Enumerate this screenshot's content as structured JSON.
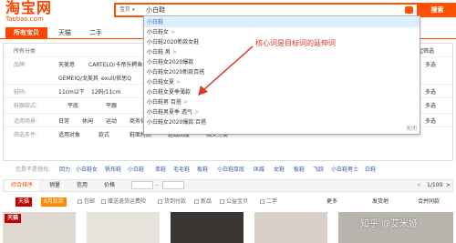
{
  "header": {
    "logo_main": "淘宝网",
    "logo_sub": "Taobao.com",
    "search_type": "宝贝",
    "search_value": "小白鞋",
    "search_button": "搜索"
  },
  "tabs": [
    "所有宝贝",
    "天猫",
    "二手"
  ],
  "filter_rows": {
    "location_label": "所有分类",
    "sidebar_label": "收起筛选",
    "brand_label": "品牌:",
    "brands_row1": [
      "天美意",
      "CARTELO/卡帝乐鳄鱼"
    ],
    "brands_row2": [
      "GEMEIQ/戈美其",
      "exull/依思Q"
    ],
    "more_label": "更多",
    "multi_label": "多选",
    "size_label": "鞋码:",
    "sizes": [
      "11cm以下",
      "12码/11cm"
    ],
    "style_label": "鞋跟款式:",
    "styles": [
      "平底",
      "平跟"
    ],
    "scene_label": "适用场景:",
    "scenes": [
      "日常",
      "休闲",
      "运动",
      "商务休闲"
    ],
    "cond_label": "筛选条件:",
    "conds": [
      "适用对象",
      "款式",
      "鞋面材质",
      "鞋跟高度",
      "相关分类"
    ]
  },
  "dropdown": {
    "items": [
      {
        "text": "小白鞋",
        "arrow": ""
      },
      {
        "text": "小白鞋女",
        "arrow": ">"
      },
      {
        "text": "小白鞋2020新款女鞋",
        "arrow": ""
      },
      {
        "text": "小白鞋 男",
        "arrow": ">"
      },
      {
        "text": "小白鞋女2020爆款",
        "arrow": ""
      },
      {
        "text": "小白鞋女2020新款百搭",
        "arrow": ""
      },
      {
        "text": "小白鞋女夏",
        "arrow": ">"
      },
      {
        "text": "小白鞋女夏季薄款",
        "arrow": ""
      },
      {
        "text": "小白鞋男 百搭",
        "arrow": ">"
      },
      {
        "text": "小白鞋男夏季 透气",
        "arrow": ">"
      },
      {
        "text": "小白鞋女2020爆款 百搭",
        "arrow": ""
      }
    ],
    "close": "关闭"
  },
  "annotation": "核心词是目标词的延伸词",
  "guess_row": {
    "label": "您是不是想找:",
    "items": [
      "回力",
      "小白鞋女",
      "帆布鞋",
      "小白鞋",
      "单鞋",
      "毛毛鞋",
      "板鞋",
      "小白鞋厚底",
      "匡威",
      "女鞋",
      "板鞋",
      "飞跃",
      "小白鞋男士",
      "白鞋"
    ]
  },
  "sort_bar": {
    "items": [
      "综合排序",
      "销量",
      "信用",
      "价格"
    ],
    "price_sep": "-",
    "prev_label": "<",
    "page_info": "1/100",
    "next_label": ">"
  },
  "filter_row2": {
    "badges": [
      "天猫",
      "6月狂欢"
    ],
    "checks": [
      "包邮",
      "赠送退货运费险",
      "货到付款",
      "新品",
      "公益宝贝",
      "二手"
    ],
    "more": "更多",
    "location": "发货地",
    "merge": "合并同款"
  },
  "products": {
    "tmall_badge": "天猫",
    "sale_badge": "6月狂欢"
  },
  "watermark": "知乎 @艾米娅"
}
